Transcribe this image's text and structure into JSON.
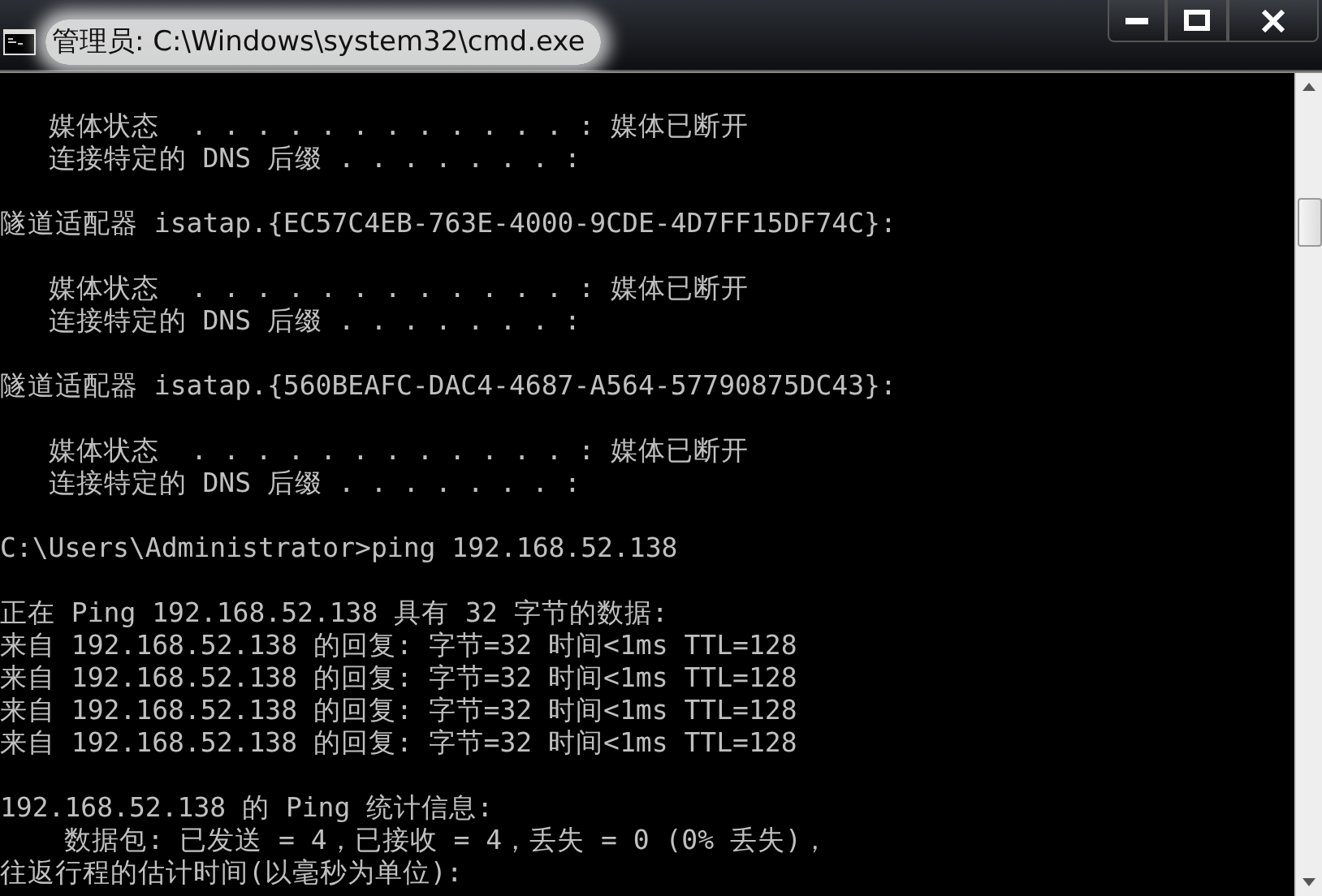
{
  "window": {
    "title": "管理员: C:\\Windows\\system32\\cmd.exe"
  },
  "console": {
    "blocks": [
      [
        "   媒体状态  . . . . . . . . . . . . : 媒体已断开",
        "   连接特定的 DNS 后缀 . . . . . . . :"
      ],
      [
        "隧道适配器 isatap.{EC57C4EB-763E-4000-9CDE-4D7FF15DF74C}:"
      ],
      [
        "   媒体状态  . . . . . . . . . . . . : 媒体已断开",
        "   连接特定的 DNS 后缀 . . . . . . . :"
      ],
      [
        "隧道适配器 isatap.{560BEAFC-DAC4-4687-A564-57790875DC43}:"
      ],
      [
        "   媒体状态  . . . . . . . . . . . . : 媒体已断开",
        "   连接特定的 DNS 后缀 . . . . . . . :"
      ],
      [
        "C:\\Users\\Administrator>ping 192.168.52.138"
      ],
      [
        "正在 Ping 192.168.52.138 具有 32 字节的数据:",
        "来自 192.168.52.138 的回复: 字节=32 时间<1ms TTL=128",
        "来自 192.168.52.138 的回复: 字节=32 时间<1ms TTL=128",
        "来自 192.168.52.138 的回复: 字节=32 时间<1ms TTL=128",
        "来自 192.168.52.138 的回复: 字节=32 时间<1ms TTL=128"
      ],
      [
        "192.168.52.138 的 Ping 统计信息:",
        "    数据包: 已发送 = 4，已接收 = 4，丢失 = 0 (0% 丢失)，",
        "往返行程的估计时间(以毫秒为单位):"
      ]
    ]
  }
}
